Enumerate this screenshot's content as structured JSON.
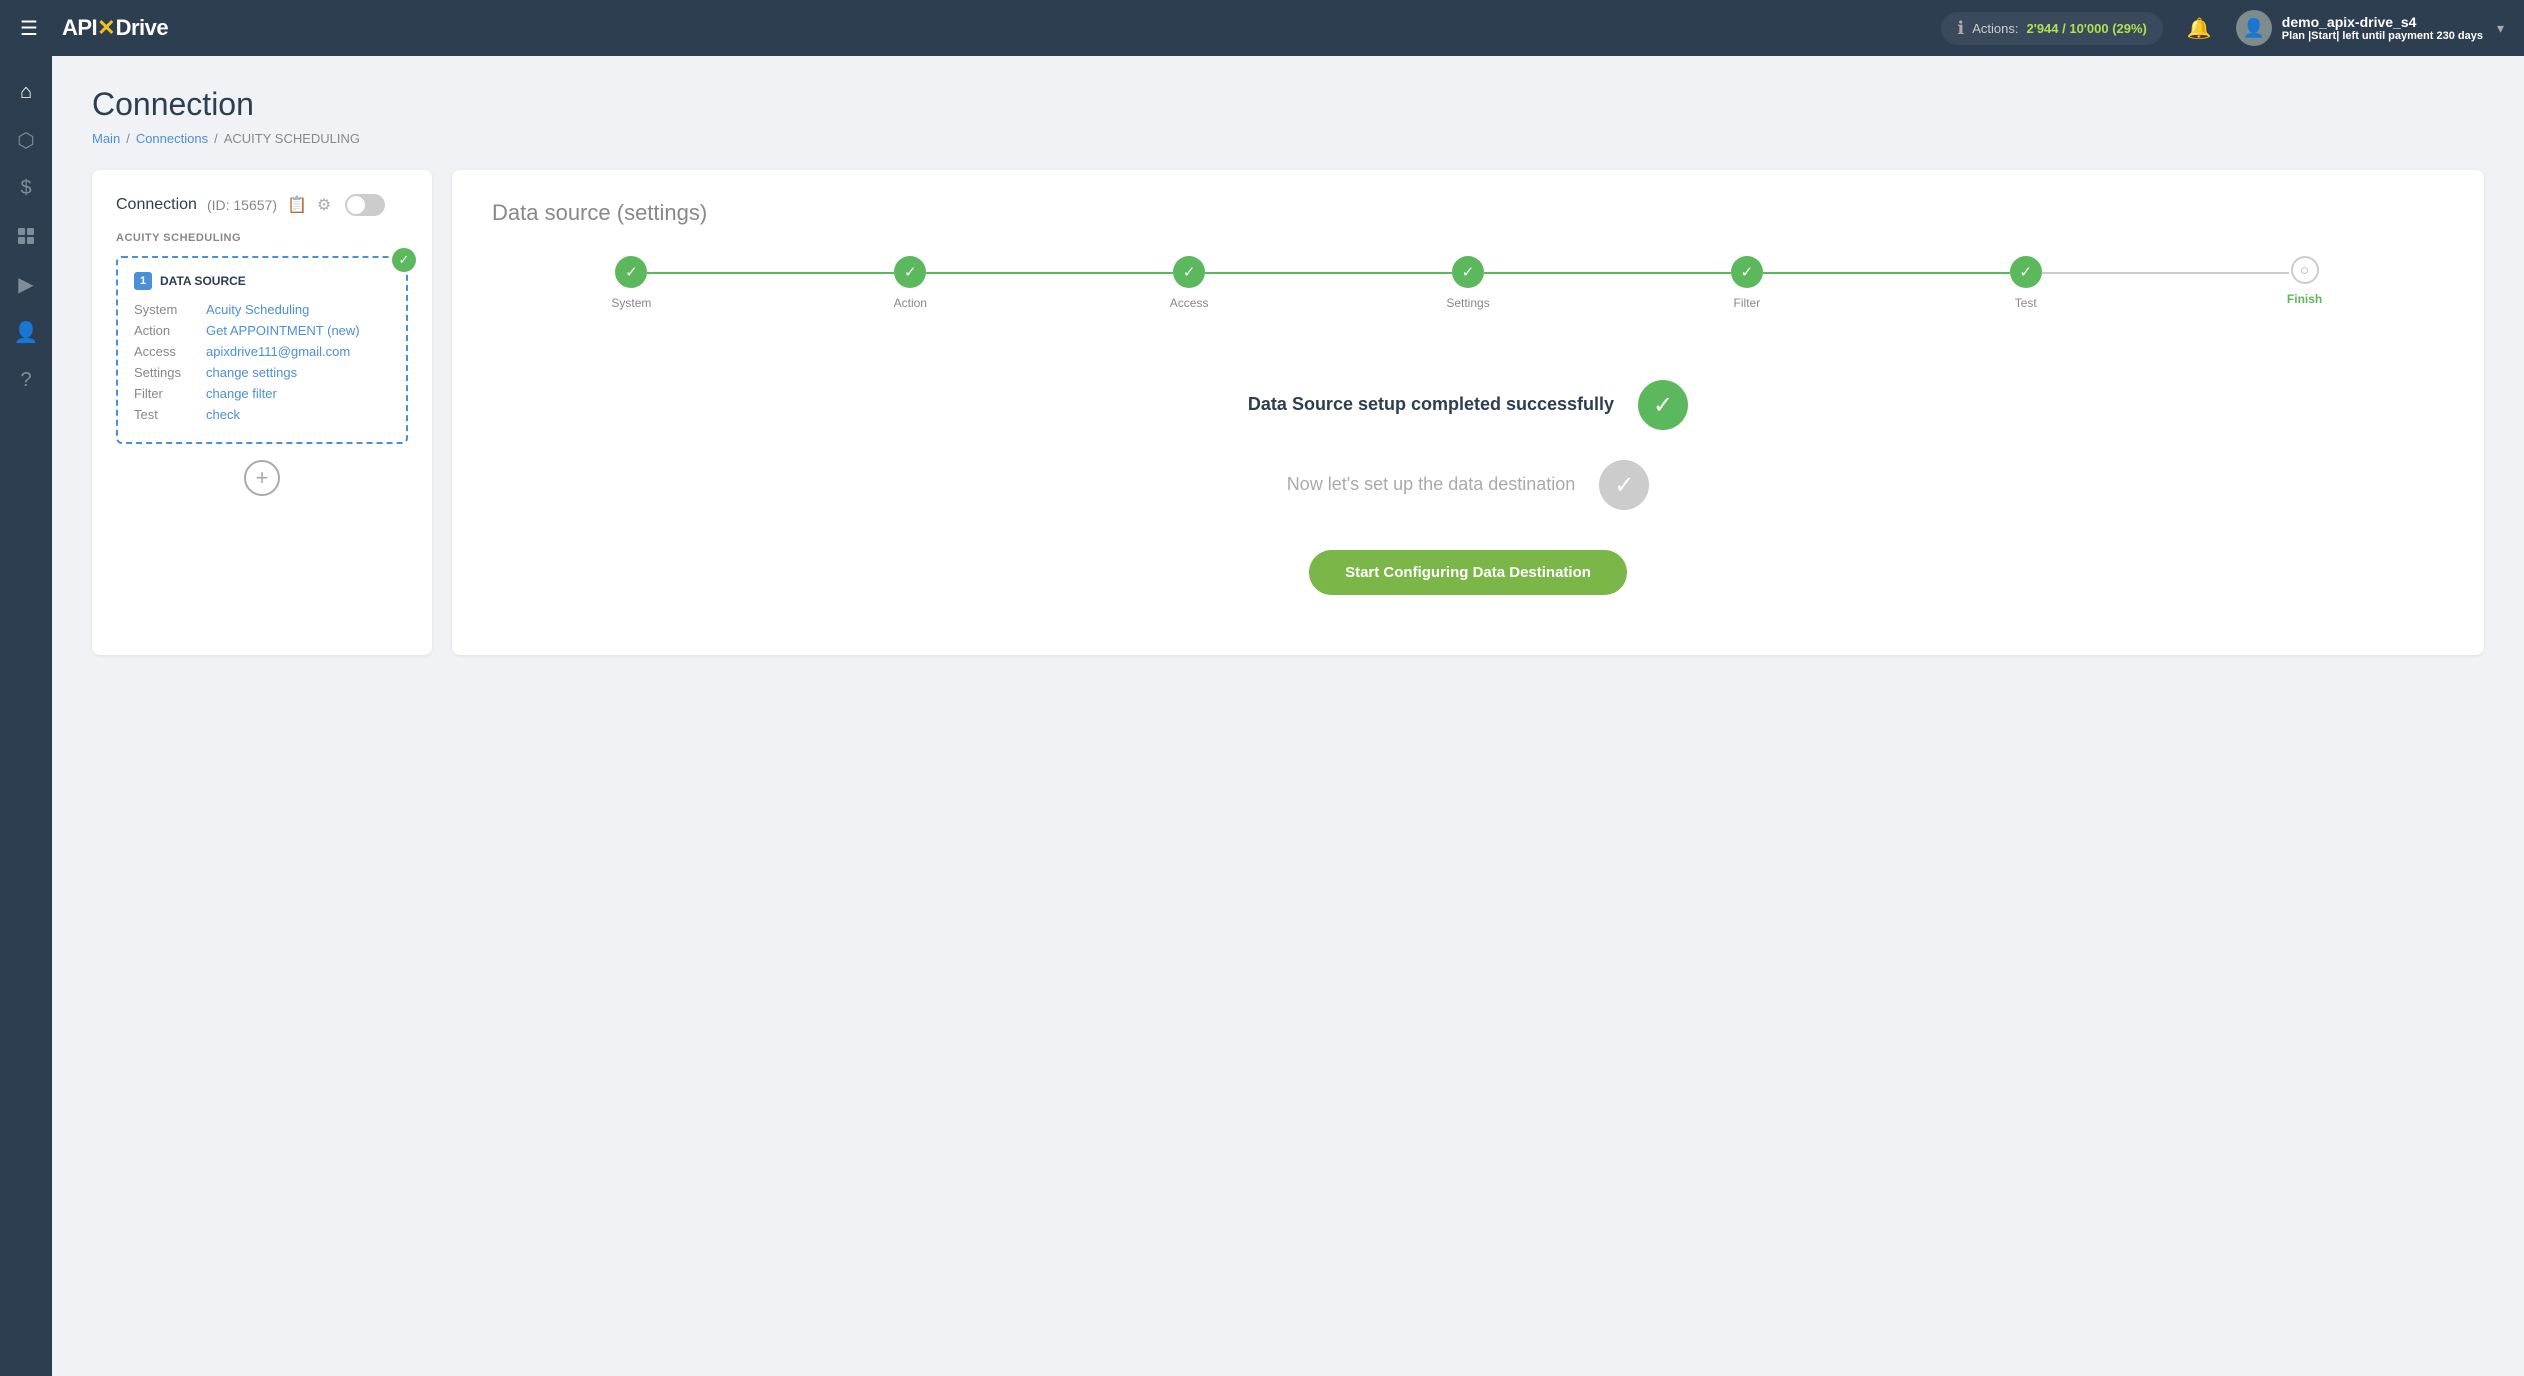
{
  "topnav": {
    "menu_icon": "☰",
    "logo_pre": "API",
    "logo_x": "✕",
    "logo_post": "Drive",
    "actions_label": "Actions:",
    "actions_value": "2'944 / 10'000 (29%)",
    "bell_icon": "🔔",
    "username": "demo_apix-drive_s4",
    "plan_text": "Plan |Start| left until payment",
    "plan_days": "230 days",
    "chevron": "▾"
  },
  "sidebar": {
    "items": [
      {
        "icon": "⌂",
        "name": "home"
      },
      {
        "icon": "⬡",
        "name": "connections"
      },
      {
        "icon": "$",
        "name": "billing"
      },
      {
        "icon": "🗂",
        "name": "templates"
      },
      {
        "icon": "▶",
        "name": "video"
      },
      {
        "icon": "👤",
        "name": "account"
      },
      {
        "icon": "?",
        "name": "help"
      }
    ]
  },
  "page": {
    "title": "Connection",
    "breadcrumb": {
      "main": "Main",
      "connections": "Connections",
      "current": "ACUITY SCHEDULING"
    }
  },
  "left_panel": {
    "title": "Connection",
    "id_label": "(ID: 15657)",
    "copy_icon": "📋",
    "settings_icon": "⚙",
    "connection_label": "ACUITY SCHEDULING",
    "data_source": {
      "num": "1",
      "title": "DATA SOURCE",
      "rows": [
        {
          "label": "System",
          "value": "Acuity Scheduling"
        },
        {
          "label": "Action",
          "value": "Get APPOINTMENT (new)"
        },
        {
          "label": "Access",
          "value": "apixdrive111@gmail.com"
        },
        {
          "label": "Settings",
          "value": "change settings"
        },
        {
          "label": "Filter",
          "value": "change filter"
        },
        {
          "label": "Test",
          "value": "check"
        }
      ]
    },
    "add_btn": "+"
  },
  "right_panel": {
    "title": "Data source",
    "title_sub": "(settings)",
    "steps": [
      {
        "label": "System",
        "state": "done"
      },
      {
        "label": "Action",
        "state": "done"
      },
      {
        "label": "Access",
        "state": "done"
      },
      {
        "label": "Settings",
        "state": "done"
      },
      {
        "label": "Filter",
        "state": "done"
      },
      {
        "label": "Test",
        "state": "done"
      },
      {
        "label": "Finish",
        "state": "current"
      }
    ],
    "success_title": "Data Source setup completed successfully",
    "next_title": "Now let's set up the data destination",
    "start_btn": "Start Configuring Data Destination"
  }
}
